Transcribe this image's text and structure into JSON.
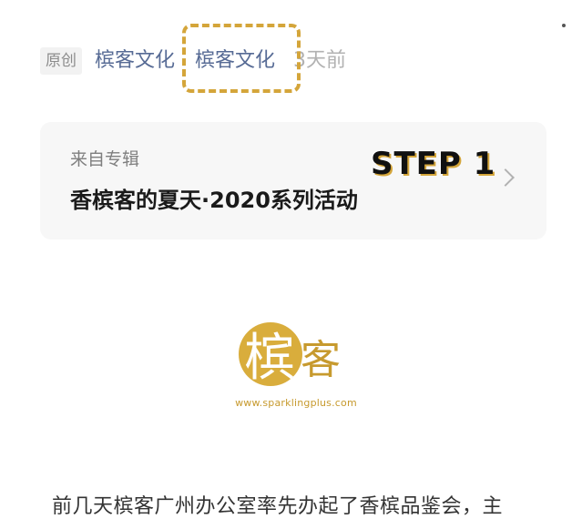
{
  "meta": {
    "badge": "原创",
    "account": "槟客文化",
    "author": "槟客文化",
    "time": "3天前"
  },
  "album": {
    "from_label": "来自专辑",
    "title": "香槟客的夏天·2020系列活动",
    "annotation": "STEP 1"
  },
  "logo": {
    "char1": "槟",
    "char2": "客",
    "url": "www.sparklingplus.com"
  },
  "article": {
    "first_line": "前几天槟客广州办公室率先办起了香槟品鉴会，主"
  },
  "colors": {
    "link": "#576b95",
    "highlight": "#d4a53a",
    "card_bg": "#f7f7f7",
    "logo_gold": "#d9ad3c"
  },
  "icons": {
    "album_arrow": "chevron-right-icon"
  }
}
